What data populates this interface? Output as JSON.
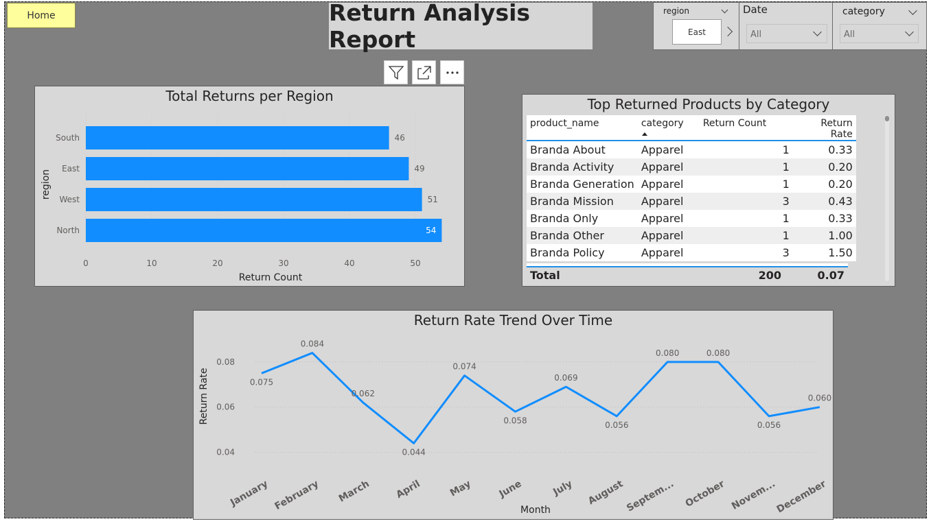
{
  "home_button": "Home",
  "report_title": "Return Analysis Report",
  "slicers": {
    "region": {
      "label": "region",
      "selected": "East"
    },
    "date": {
      "label": "Date",
      "selected": "All"
    },
    "category": {
      "label": "category",
      "selected": "All"
    }
  },
  "bar_visual": {
    "title": "Total Returns per Region",
    "xlabel": "Return Count",
    "ylabel": "region"
  },
  "table_visual": {
    "title": "Top Returned Products by Category",
    "columns": [
      "product_name",
      "category",
      "Return Count",
      "Return Rate"
    ],
    "rows": [
      [
        "Branda About",
        "Apparel",
        "1",
        "0.33"
      ],
      [
        "Branda Activity",
        "Apparel",
        "1",
        "0.20"
      ],
      [
        "Branda Generation",
        "Apparel",
        "1",
        "0.20"
      ],
      [
        "Branda Mission",
        "Apparel",
        "3",
        "0.43"
      ],
      [
        "Branda Only",
        "Apparel",
        "1",
        "0.33"
      ],
      [
        "Branda Other",
        "Apparel",
        "1",
        "1.00"
      ],
      [
        "Branda Policy",
        "Apparel",
        "3",
        "1.50"
      ]
    ],
    "total": {
      "label": "Total",
      "count": "200",
      "rate": "0.07"
    }
  },
  "line_visual": {
    "title": "Return Rate Trend Over Time",
    "xlabel": "Month",
    "ylabel": "Return Rate"
  },
  "colors": {
    "bar": "#118dff",
    "line": "#118dff",
    "canvas": "#808080",
    "visual_bg": "#d8d8d8",
    "home_button": "#fefe9c"
  },
  "chart_data": [
    {
      "type": "bar",
      "orientation": "horizontal",
      "title": "Total Returns per Region",
      "xlabel": "Return Count",
      "ylabel": "region",
      "categories": [
        "South",
        "East",
        "West",
        "North"
      ],
      "values": [
        46,
        49,
        51,
        54
      ],
      "value_labels": [
        "46",
        "49",
        "51",
        "54"
      ],
      "xlim": [
        0,
        55
      ],
      "xticks": [
        0,
        10,
        20,
        30,
        40,
        50
      ],
      "xtick_labels": [
        "0",
        "10",
        "20",
        "30",
        "40",
        "50"
      ]
    },
    {
      "type": "line",
      "title": "Return Rate Trend Over Time",
      "xlabel": "Month",
      "ylabel": "Return Rate",
      "categories": [
        "January",
        "February",
        "March",
        "April",
        "May",
        "June",
        "July",
        "August",
        "Septem...",
        "October",
        "Novem...",
        "December"
      ],
      "values": [
        0.075,
        0.084,
        0.062,
        0.044,
        0.074,
        0.058,
        0.069,
        0.056,
        0.08,
        0.08,
        0.056,
        0.06
      ],
      "value_labels": [
        "0.075",
        "0.084",
        "0.062",
        "0.044",
        "0.074",
        "0.058",
        "0.069",
        "0.056",
        "0.080",
        "0.080",
        "0.056",
        "0.060"
      ],
      "ylim": [
        0.035,
        0.09
      ],
      "yticks": [
        0.04,
        0.06,
        0.08
      ],
      "ytick_labels": [
        "0.04",
        "0.06",
        "0.08"
      ],
      "grid": true
    }
  ]
}
